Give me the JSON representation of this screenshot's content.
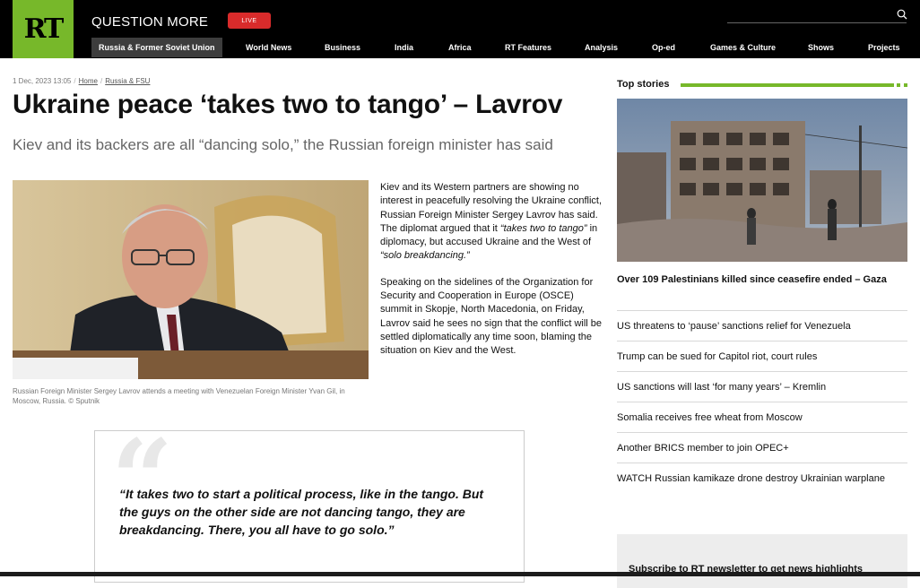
{
  "header": {
    "logo_text": "RT",
    "slogan": "QUESTION MORE",
    "live_label": "LIVE",
    "search_placeholder": ""
  },
  "nav": {
    "items": [
      {
        "label": "Russia & Former Soviet Union",
        "active": true
      },
      {
        "label": "World News"
      },
      {
        "label": "Business"
      },
      {
        "label": "India"
      },
      {
        "label": "Africa"
      },
      {
        "label": "RT Features"
      },
      {
        "label": "Analysis"
      },
      {
        "label": "Op-ed"
      },
      {
        "label": "Games & Culture"
      },
      {
        "label": "Shows"
      },
      {
        "label": "Projects"
      }
    ]
  },
  "article": {
    "date": "1 Dec, 2023 13:05",
    "breadcrumbs": [
      "Home",
      "Russia & FSU"
    ],
    "title": "Ukraine peace ‘takes two to tango’ – Lavrov",
    "subtitle": "Kiev and its backers are all “dancing solo,” the Russian foreign minister has said",
    "caption": "Russian Foreign Minister Sergey Lavrov attends a meeting with Venezuelan Foreign Minister Yvan Gil, in Moscow, Russia. ©  Sputnik",
    "p1_a": "Kiev and its Western partners are showing no interest in peacefully resolving the Ukraine conflict, Russian Foreign Minister Sergey Lavrov has said. The diplomat argued that it ",
    "p1_italic1": "“takes two to tango”",
    "p1_b": " in diplomacy, but accused Ukraine and the West of ",
    "p1_italic2": "“solo breakdancing.”",
    "p2": "Speaking on the sidelines of the Organization for Security and Cooperation in Europe (OSCE) summit in Skopje, North Macedonia, on Friday, Lavrov said he sees no sign that the conflict will be settled diplomatically any time soon, blaming the situation on Kiev and the West.",
    "quote": "“It takes two to start a political process, like in the tango. But the guys on the other side are not dancing tango, they are breakdancing. There, you all have to go solo.”"
  },
  "sidebar": {
    "heading": "Top stories",
    "lead_story": "Over 109 Palestinians killed since ceasefire ended – Gaza",
    "stories": [
      "US threatens to ‘pause’ sanctions relief for Venezuela",
      "Trump can be sued for Capitol riot, court rules",
      "US sanctions will last ‘for many years’ – Kremlin",
      "Somalia receives free wheat from Moscow",
      "Another BRICS member to join OPEC+",
      "WATCH Russian kamikaze drone destroy Ukrainian warplane"
    ],
    "newsletter": "Subscribe to RT newsletter to get news highlights"
  },
  "colors": {
    "brand_green": "#77b82a",
    "live_red": "#d92b2b",
    "header_bg": "#000000"
  }
}
